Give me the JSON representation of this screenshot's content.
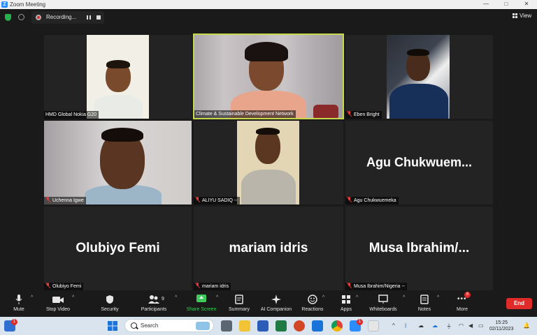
{
  "window": {
    "title": "Zoom Meeting",
    "minimize": "—",
    "maximize": "□",
    "close": "✕"
  },
  "topbar": {
    "recording_label": "Recording...",
    "view_label": "View"
  },
  "participants": [
    {
      "name": "HMD Global Nokia G20",
      "muted": false,
      "video": true
    },
    {
      "name": "Climate & Sustainable Development Network",
      "muted": false,
      "video": true,
      "active_speaker": true
    },
    {
      "name": "Eben Bright",
      "muted": true,
      "video": true
    },
    {
      "name": "Uchenna Igwe",
      "muted": true,
      "video": true
    },
    {
      "name": "ALIYU SADIQ --",
      "muted": true,
      "video": true
    },
    {
      "name": "Agu Chukwuemeka",
      "display_name": "Agu  Chukwuem...",
      "muted": true,
      "video": false
    },
    {
      "name": "Olubiyo Femi",
      "display_name": "Olubiyo Femi",
      "muted": true,
      "video": false
    },
    {
      "name": "mariam idris",
      "display_name": "mariam idris",
      "muted": true,
      "video": false
    },
    {
      "name": "Musa Ibrahim/Nigeria --",
      "display_name": "Musa  Ibrahim/...",
      "muted": true,
      "video": false
    }
  ],
  "toolbar": {
    "mute": "Mute",
    "stop_video": "Stop Video",
    "security": "Security",
    "participants": "Participants",
    "participants_count": "9",
    "share_screen": "Share Screen",
    "summary": "Summary",
    "ai_companion": "AI Companion",
    "reactions": "Reactions",
    "apps": "Apps",
    "whiteboards": "Whiteboards",
    "notes": "Notes",
    "more": "More",
    "more_badge": "6",
    "end": "End"
  },
  "taskbar": {
    "search_placeholder": "Search",
    "time": "15:25",
    "date": "02/11/2023",
    "weather_badge": "1",
    "zoom_badge": "1"
  },
  "colors": {
    "active_border": "#c6d94a",
    "end_button": "#e02b2b",
    "share_green": "#3ecb5b",
    "muted_red": "#e03a3a"
  }
}
